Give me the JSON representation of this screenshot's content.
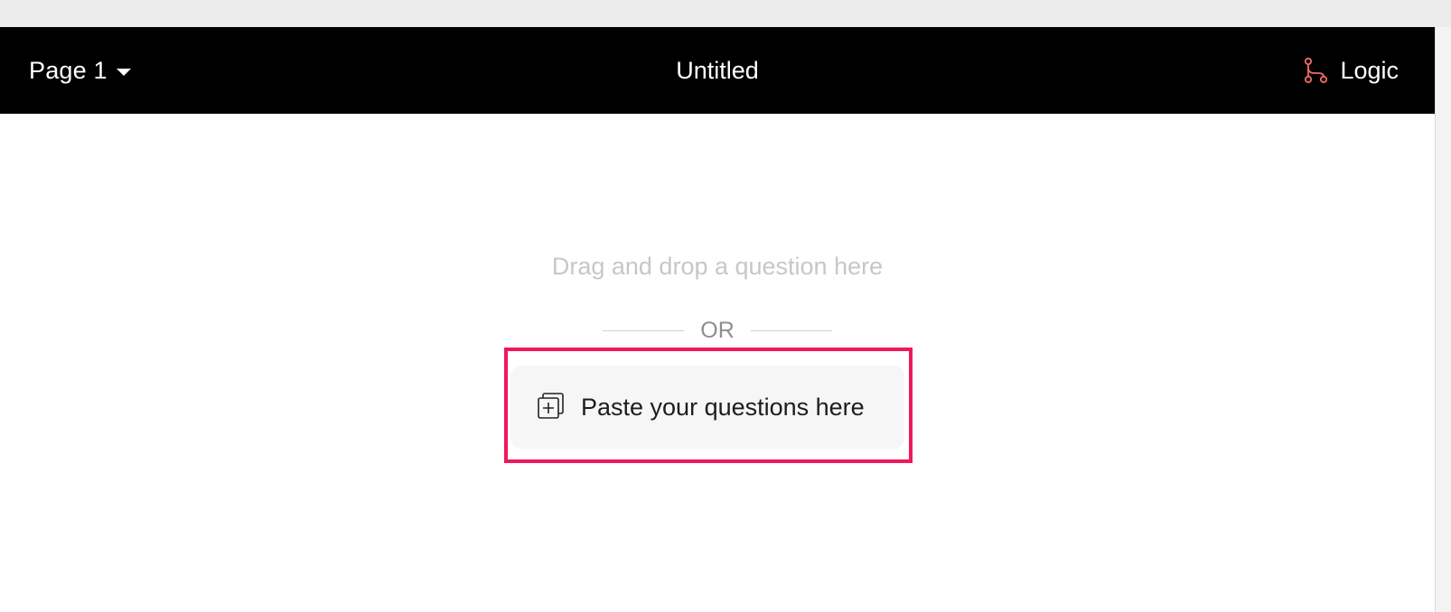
{
  "header": {
    "page_label": "Page 1",
    "form_title": "Untitled",
    "logic_label": "Logic",
    "logic_icon": "logic-branch-icon",
    "logic_icon_color": "#f26b6b"
  },
  "dropzone": {
    "hint": "Drag and drop a question here",
    "separator": "OR",
    "paste_label": "Paste your questions here",
    "paste_icon": "paste-add-icon"
  },
  "colors": {
    "header_bg": "#000000",
    "highlight": "#f0185a",
    "paste_bg": "#f5f6f5"
  }
}
